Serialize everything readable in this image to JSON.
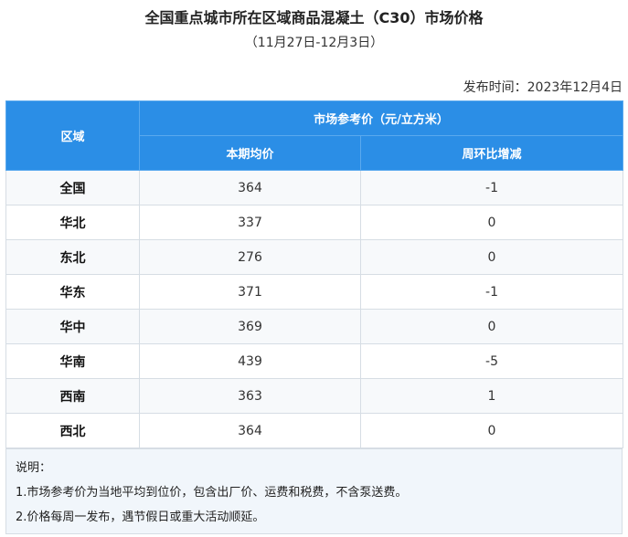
{
  "title": "全国重点城市所在区域商品混凝土（C30）市场价格",
  "subtitle": "（11月27日-12月3日）",
  "release": "发布时间：2023年12月4日",
  "table": {
    "header_region": "区域",
    "header_market": "市场参考价（元/立方米）",
    "header_avg": "本期均价",
    "header_change": "周环比增减",
    "rows": [
      {
        "region": "全国",
        "avg": "364",
        "change": "-1"
      },
      {
        "region": "华北",
        "avg": "337",
        "change": "0"
      },
      {
        "region": "东北",
        "avg": "276",
        "change": "0"
      },
      {
        "region": "华东",
        "avg": "371",
        "change": "-1"
      },
      {
        "region": "华中",
        "avg": "369",
        "change": "0"
      },
      {
        "region": "华南",
        "avg": "439",
        "change": "-5"
      },
      {
        "region": "西南",
        "avg": "363",
        "change": "1"
      },
      {
        "region": "西北",
        "avg": "364",
        "change": "0"
      }
    ]
  },
  "notes": {
    "heading": "说明：",
    "line1": "1.市场参考价为当地平均到位价，包含出厂价、运费和税费，不含泵送费。",
    "line2": "2.价格每周一发布，遇节假日或重大活动顺延。"
  }
}
